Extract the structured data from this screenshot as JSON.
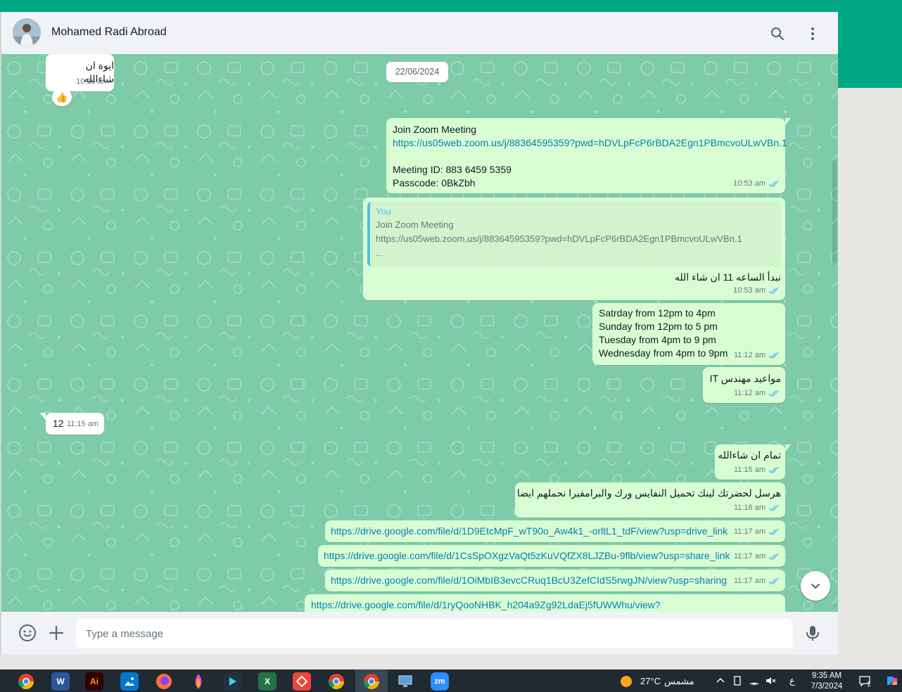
{
  "header": {
    "contact_name": "Mohamed Radi Abroad",
    "icons": [
      "search-icon",
      "menu-dots-icon"
    ]
  },
  "date_divider": "22/06/2024",
  "messages": [
    {
      "dir": "in",
      "text": "ايوة ان شاءالله",
      "time": "10:16 am",
      "reaction": "👍"
    },
    {
      "dir": "out",
      "lines": [
        "Join Zoom Meeting",
        "https://us05web.zoom.us/j/88364595359?pwd=hDVLpFcP6rBDA2Egn1PBmcvoULwVBn.1",
        "",
        "Meeting ID: 883 6459 5359",
        "Passcode: 0BkZbh"
      ],
      "time": "10:53 am"
    },
    {
      "dir": "out",
      "quote_author": "You",
      "quote_lines": [
        "Join Zoom Meeting",
        "https://us05web.zoom.us/j/88364595359?pwd=hDVLpFcP6rBDA2Egn1PBmcvoULwVBn.1",
        "..."
      ],
      "text": "نبدأ الساعه 11 ان شاء الله",
      "time": "10:53 am"
    },
    {
      "dir": "out",
      "lines": [
        "Satrday from 12pm to 4pm",
        "Sunday from 12pm to 5 pm",
        "Tuesday from 4pm to 9 pm",
        "Wednesday from 4pm to 9pm"
      ],
      "time": "11:12 am"
    },
    {
      "dir": "out",
      "text": "مواعيد مهندس IT",
      "time": "11:12 am"
    },
    {
      "dir": "in",
      "text": "12",
      "time": "11:15 am"
    },
    {
      "dir": "out",
      "text": "تمام ان شاءالله",
      "time": "11:15 am"
    },
    {
      "dir": "out",
      "text": "هرسل لحضرتك لينك تحميل النفايس ورك والبرامفيرا نحملهم ايضا",
      "time": "11:16 am"
    },
    {
      "dir": "out",
      "link": "https://drive.google.com/file/d/1D9EtcMpF_wT90o_Aw4k1_-orltL1_tdF/view?usp=drive_link",
      "time": "11:17 am"
    },
    {
      "dir": "out",
      "link": "https://drive.google.com/file/d/1CsSpOXgzVaQt5zKuVQfZX8LJZBu-9flb/view?usp=share_link",
      "time": "11:17 am"
    },
    {
      "dir": "out",
      "link": "https://drive.google.com/file/d/1OiMbIB3evcCRuq1BcU3ZefCIdS5rwgJN/view?usp=sharing",
      "time": "11:17 am"
    },
    {
      "dir": "out",
      "link": "https://drive.google.com/file/d/1ryQooNHBK_h204a9Zg92LdaEj5fUWWhu/view?",
      "time": ""
    }
  ],
  "composer": {
    "placeholder": "Type a message",
    "icons": [
      "emoji-icon",
      "plus-icon",
      "microphone-icon"
    ]
  },
  "taskbar": {
    "apps": [
      "chrome",
      "word",
      "illustrator",
      "photos",
      "firefox",
      "paint",
      "app",
      "excel",
      "anydesk",
      "chrome-profile",
      "chrome-active",
      "remote-desktop",
      "zoom"
    ],
    "illustrator_label": "Ai",
    "zoom_label": "zm",
    "weather": "27°C",
    "weather_desc": "مشمس",
    "lang": "ع",
    "time": "9:35 AM",
    "date": "7/3/2024",
    "notification_count": "1"
  },
  "colors": {
    "header_bg": "#f0f2f5",
    "chat_bg": "#7ecba9",
    "outgoing": "#d9fdd3",
    "incoming": "#ffffff",
    "link": "#027eb5",
    "accent": "#00a884",
    "read_ticks": "#53bdeb"
  }
}
